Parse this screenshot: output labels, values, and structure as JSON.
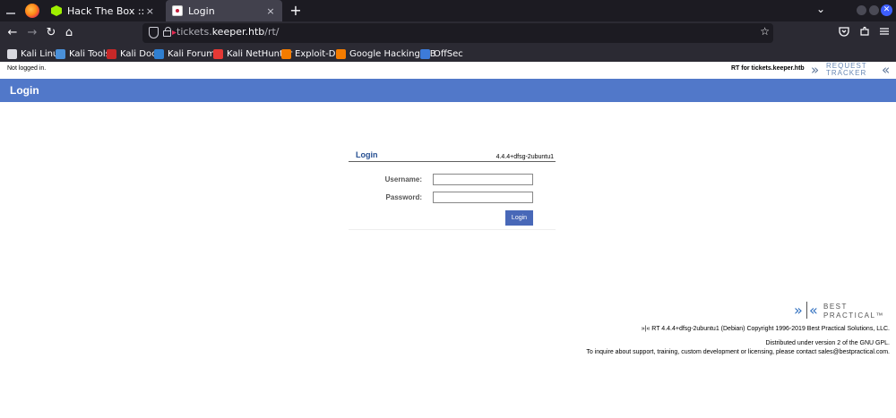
{
  "browser": {
    "tabs": [
      {
        "label": "Hack The Box :: Hack The",
        "close": "×"
      },
      {
        "label": "Login",
        "close": "×"
      }
    ],
    "new_tab": "+",
    "tabs_menu": "⌄",
    "window_close": "✕",
    "nav": {
      "back": "←",
      "forward": "→",
      "reload": "↻",
      "home": "⌂"
    },
    "url": {
      "host": "tickets.keeper.htb",
      "path": "/rt/",
      "scheme_hidden": "tickets."
    },
    "bookmark_star": "☆",
    "bookmarks": [
      {
        "label": "Kali Linux",
        "icon": "kali-dragon-icon",
        "color": "#d9d9e0"
      },
      {
        "label": "Kali Tools",
        "icon": "kali-tools-icon",
        "color": "#4a90d9"
      },
      {
        "label": "Kali Docs",
        "icon": "kali-docs-icon",
        "color": "#c62828"
      },
      {
        "label": "Kali Forums",
        "icon": "kali-forums-icon",
        "color": "#2f7fd1"
      },
      {
        "label": "Kali NetHunter",
        "icon": "nethunter-icon",
        "color": "#e53935"
      },
      {
        "label": "Exploit-DB",
        "icon": "exploit-db-icon",
        "color": "#f57c00"
      },
      {
        "label": "Google Hacking DB",
        "icon": "ghdb-icon",
        "color": "#f57c00"
      },
      {
        "label": "OffSec",
        "icon": "offsec-icon",
        "color": "#3d7bd9"
      }
    ]
  },
  "rt": {
    "status": "Not logged in.",
    "rt_for": "RT for tickets.keeper.htb",
    "logo_words": [
      "REQUEST",
      "TRACKER"
    ],
    "page_title": "Login",
    "login": {
      "title": "Login",
      "version": "4.4.4+dfsg-2ubuntu1",
      "username_label": "Username:",
      "password_label": "Password:",
      "username_value": "",
      "password_value": "",
      "button": "Login"
    },
    "bp_logo_words": [
      "BEST",
      "PRACTICAL™"
    ],
    "footer": {
      "copyright": "»|« RT 4.4.4+dfsg-2ubuntu1 (Debian) Copyright 1996-2019 Best Practical Solutions, LLC.",
      "license": "Distributed under version 2 of the GNU GPL.",
      "contact": "To inquire about support, training, custom development or licensing, please contact sales@bestpractical.com."
    }
  },
  "colors": {
    "title_bar": "#5178c9",
    "login_button": "#4868b8",
    "accent_blue": "#264f92"
  }
}
